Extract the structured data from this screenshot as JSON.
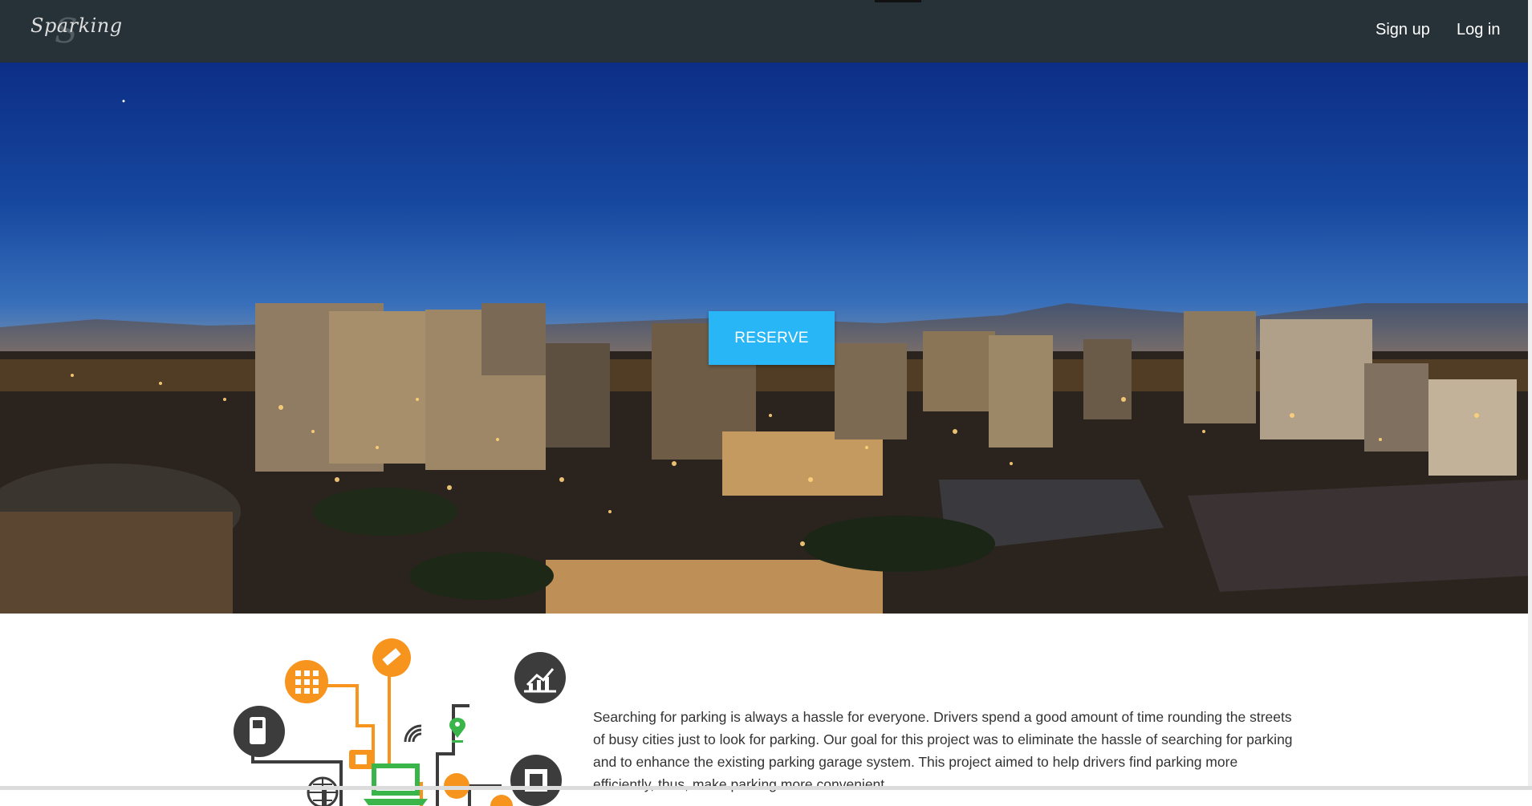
{
  "brand": {
    "name": "Sparking"
  },
  "nav": {
    "signup_label": "Sign up",
    "login_label": "Log in"
  },
  "hero": {
    "reserve_label": "RESERVE"
  },
  "about": {
    "text": "Searching for parking is always a hassle for everyone. Drivers spend a good amount of time rounding the streets of busy cities just to look for parking. Our goal for this project was to eliminate the hassle of searching for parking and to enhance the existing parking garage system. This project aimed to help drivers find parking more efficiently, thus, make parking more convenient."
  },
  "colors": {
    "navbar": "#263238",
    "accent": "#29b6f6",
    "infographic_orange": "#f7941d",
    "infographic_dark": "#3c3c3c",
    "infographic_green": "#39b54a"
  },
  "icons": {
    "infographic": [
      "grid-icon",
      "satellite-icon",
      "chart-icon",
      "mobile-icon",
      "wifi-icon",
      "location-pin-icon",
      "chip-icon",
      "globe-icon",
      "laptop-icon",
      "camera-icon"
    ]
  }
}
